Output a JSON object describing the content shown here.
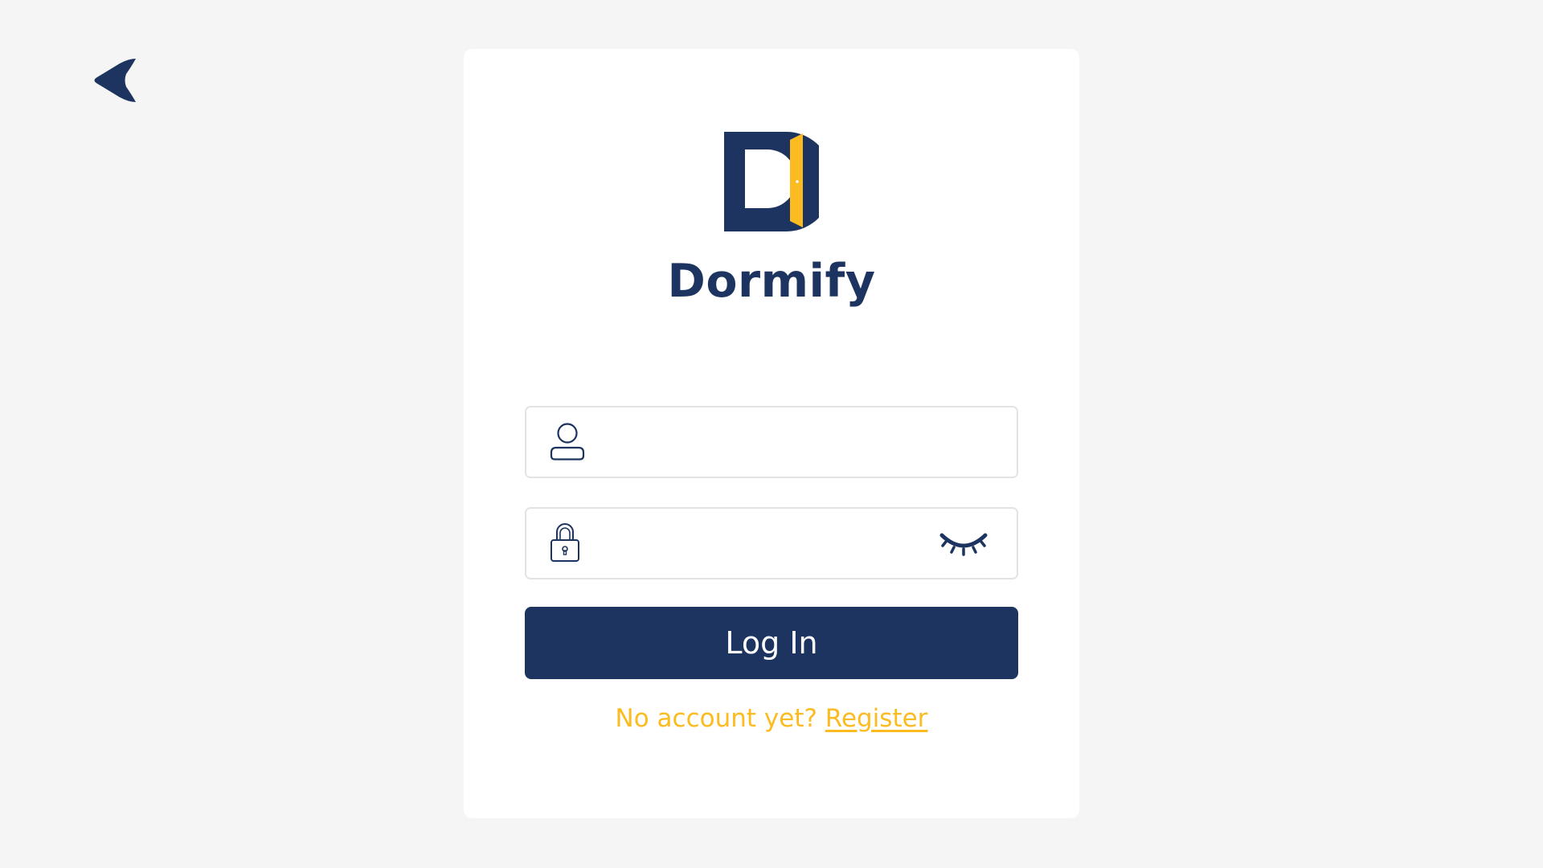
{
  "app": {
    "name": "Dormify"
  },
  "icons": {
    "back": "back-arrow-icon",
    "user": "user-icon",
    "lock": "lock-icon",
    "password_toggle": "eye-closed-icon"
  },
  "login_form": {
    "username_field": {
      "value": "",
      "placeholder": ""
    },
    "password_field": {
      "value": "",
      "placeholder": ""
    },
    "submit_label": "Log In"
  },
  "register_prompt": {
    "text": "No account yet?",
    "link_label": "Register"
  },
  "colors": {
    "background": "#f5f5f5",
    "card": "#ffffff",
    "primary": "#1c345f",
    "accent": "#fbbb21",
    "field_border": "#e3e3e5"
  }
}
